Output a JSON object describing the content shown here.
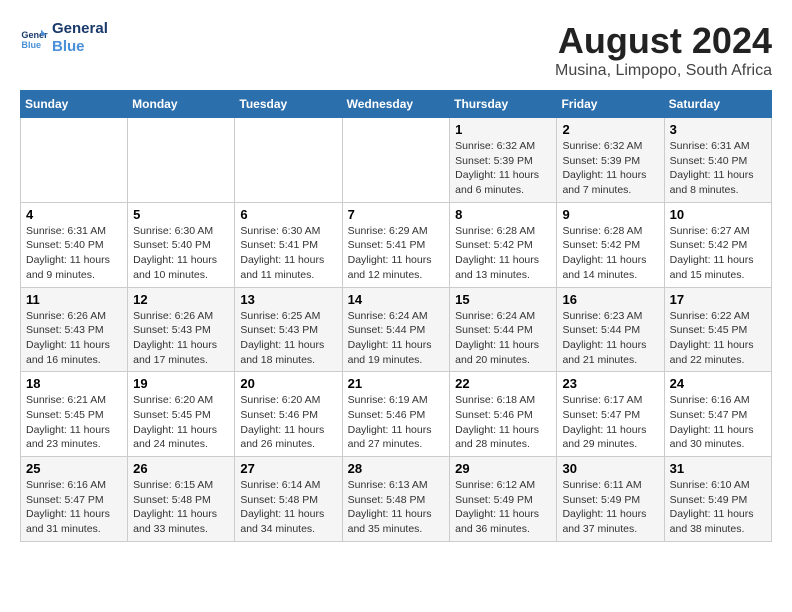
{
  "header": {
    "logo_line1": "General",
    "logo_line2": "Blue",
    "main_title": "August 2024",
    "subtitle": "Musina, Limpopo, South Africa"
  },
  "weekdays": [
    "Sunday",
    "Monday",
    "Tuesday",
    "Wednesday",
    "Thursday",
    "Friday",
    "Saturday"
  ],
  "weeks": [
    [
      {
        "day": "",
        "info": ""
      },
      {
        "day": "",
        "info": ""
      },
      {
        "day": "",
        "info": ""
      },
      {
        "day": "",
        "info": ""
      },
      {
        "day": "1",
        "info": "Sunrise: 6:32 AM\nSunset: 5:39 PM\nDaylight: 11 hours and 6 minutes."
      },
      {
        "day": "2",
        "info": "Sunrise: 6:32 AM\nSunset: 5:39 PM\nDaylight: 11 hours and 7 minutes."
      },
      {
        "day": "3",
        "info": "Sunrise: 6:31 AM\nSunset: 5:40 PM\nDaylight: 11 hours and 8 minutes."
      }
    ],
    [
      {
        "day": "4",
        "info": "Sunrise: 6:31 AM\nSunset: 5:40 PM\nDaylight: 11 hours and 9 minutes."
      },
      {
        "day": "5",
        "info": "Sunrise: 6:30 AM\nSunset: 5:40 PM\nDaylight: 11 hours and 10 minutes."
      },
      {
        "day": "6",
        "info": "Sunrise: 6:30 AM\nSunset: 5:41 PM\nDaylight: 11 hours and 11 minutes."
      },
      {
        "day": "7",
        "info": "Sunrise: 6:29 AM\nSunset: 5:41 PM\nDaylight: 11 hours and 12 minutes."
      },
      {
        "day": "8",
        "info": "Sunrise: 6:28 AM\nSunset: 5:42 PM\nDaylight: 11 hours and 13 minutes."
      },
      {
        "day": "9",
        "info": "Sunrise: 6:28 AM\nSunset: 5:42 PM\nDaylight: 11 hours and 14 minutes."
      },
      {
        "day": "10",
        "info": "Sunrise: 6:27 AM\nSunset: 5:42 PM\nDaylight: 11 hours and 15 minutes."
      }
    ],
    [
      {
        "day": "11",
        "info": "Sunrise: 6:26 AM\nSunset: 5:43 PM\nDaylight: 11 hours and 16 minutes."
      },
      {
        "day": "12",
        "info": "Sunrise: 6:26 AM\nSunset: 5:43 PM\nDaylight: 11 hours and 17 minutes."
      },
      {
        "day": "13",
        "info": "Sunrise: 6:25 AM\nSunset: 5:43 PM\nDaylight: 11 hours and 18 minutes."
      },
      {
        "day": "14",
        "info": "Sunrise: 6:24 AM\nSunset: 5:44 PM\nDaylight: 11 hours and 19 minutes."
      },
      {
        "day": "15",
        "info": "Sunrise: 6:24 AM\nSunset: 5:44 PM\nDaylight: 11 hours and 20 minutes."
      },
      {
        "day": "16",
        "info": "Sunrise: 6:23 AM\nSunset: 5:44 PM\nDaylight: 11 hours and 21 minutes."
      },
      {
        "day": "17",
        "info": "Sunrise: 6:22 AM\nSunset: 5:45 PM\nDaylight: 11 hours and 22 minutes."
      }
    ],
    [
      {
        "day": "18",
        "info": "Sunrise: 6:21 AM\nSunset: 5:45 PM\nDaylight: 11 hours and 23 minutes."
      },
      {
        "day": "19",
        "info": "Sunrise: 6:20 AM\nSunset: 5:45 PM\nDaylight: 11 hours and 24 minutes."
      },
      {
        "day": "20",
        "info": "Sunrise: 6:20 AM\nSunset: 5:46 PM\nDaylight: 11 hours and 26 minutes."
      },
      {
        "day": "21",
        "info": "Sunrise: 6:19 AM\nSunset: 5:46 PM\nDaylight: 11 hours and 27 minutes."
      },
      {
        "day": "22",
        "info": "Sunrise: 6:18 AM\nSunset: 5:46 PM\nDaylight: 11 hours and 28 minutes."
      },
      {
        "day": "23",
        "info": "Sunrise: 6:17 AM\nSunset: 5:47 PM\nDaylight: 11 hours and 29 minutes."
      },
      {
        "day": "24",
        "info": "Sunrise: 6:16 AM\nSunset: 5:47 PM\nDaylight: 11 hours and 30 minutes."
      }
    ],
    [
      {
        "day": "25",
        "info": "Sunrise: 6:16 AM\nSunset: 5:47 PM\nDaylight: 11 hours and 31 minutes."
      },
      {
        "day": "26",
        "info": "Sunrise: 6:15 AM\nSunset: 5:48 PM\nDaylight: 11 hours and 33 minutes."
      },
      {
        "day": "27",
        "info": "Sunrise: 6:14 AM\nSunset: 5:48 PM\nDaylight: 11 hours and 34 minutes."
      },
      {
        "day": "28",
        "info": "Sunrise: 6:13 AM\nSunset: 5:48 PM\nDaylight: 11 hours and 35 minutes."
      },
      {
        "day": "29",
        "info": "Sunrise: 6:12 AM\nSunset: 5:49 PM\nDaylight: 11 hours and 36 minutes."
      },
      {
        "day": "30",
        "info": "Sunrise: 6:11 AM\nSunset: 5:49 PM\nDaylight: 11 hours and 37 minutes."
      },
      {
        "day": "31",
        "info": "Sunrise: 6:10 AM\nSunset: 5:49 PM\nDaylight: 11 hours and 38 minutes."
      }
    ]
  ]
}
